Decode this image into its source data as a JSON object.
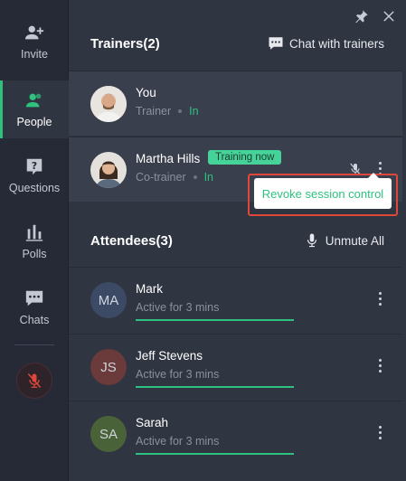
{
  "sidebar": {
    "items": [
      {
        "label": "Invite",
        "icon": "add-user-icon"
      },
      {
        "label": "People",
        "icon": "people-icon",
        "active": true
      },
      {
        "label": "Questions",
        "icon": "question-icon"
      },
      {
        "label": "Polls",
        "icon": "polls-icon"
      },
      {
        "label": "Chats",
        "icon": "chat-icon"
      }
    ],
    "mic_button_icon": "mic-muted-icon"
  },
  "topbar": {
    "pin_icon": "pin-icon",
    "close_icon": "close-icon"
  },
  "trainers": {
    "title": "Trainers(2)",
    "chat_label": "Chat with trainers",
    "rows": [
      {
        "name": "You",
        "role": "Trainer",
        "status": "In"
      },
      {
        "name": "Martha Hills",
        "role": "Co-trainer",
        "status": "In",
        "badge": "Training now"
      }
    ]
  },
  "popup": {
    "label": "Revoke session control"
  },
  "attendees": {
    "title": "Attendees(3)",
    "unmute_label": "Unmute All",
    "rows": [
      {
        "initials": "MA",
        "name": "Mark",
        "activity": "Active for 3 mins",
        "avatar_color": "#3d4a66"
      },
      {
        "initials": "JS",
        "name": "Jeff Stevens",
        "activity": "Active for 3 mins",
        "avatar_color": "#6b3a3a"
      },
      {
        "initials": "SA",
        "name": "Sarah",
        "activity": "Active for 3 mins",
        "avatar_color": "#4a6238"
      }
    ]
  },
  "colors": {
    "accent": "#2ec27e",
    "highlight": "#e0473b",
    "badge": "#45d39a"
  }
}
